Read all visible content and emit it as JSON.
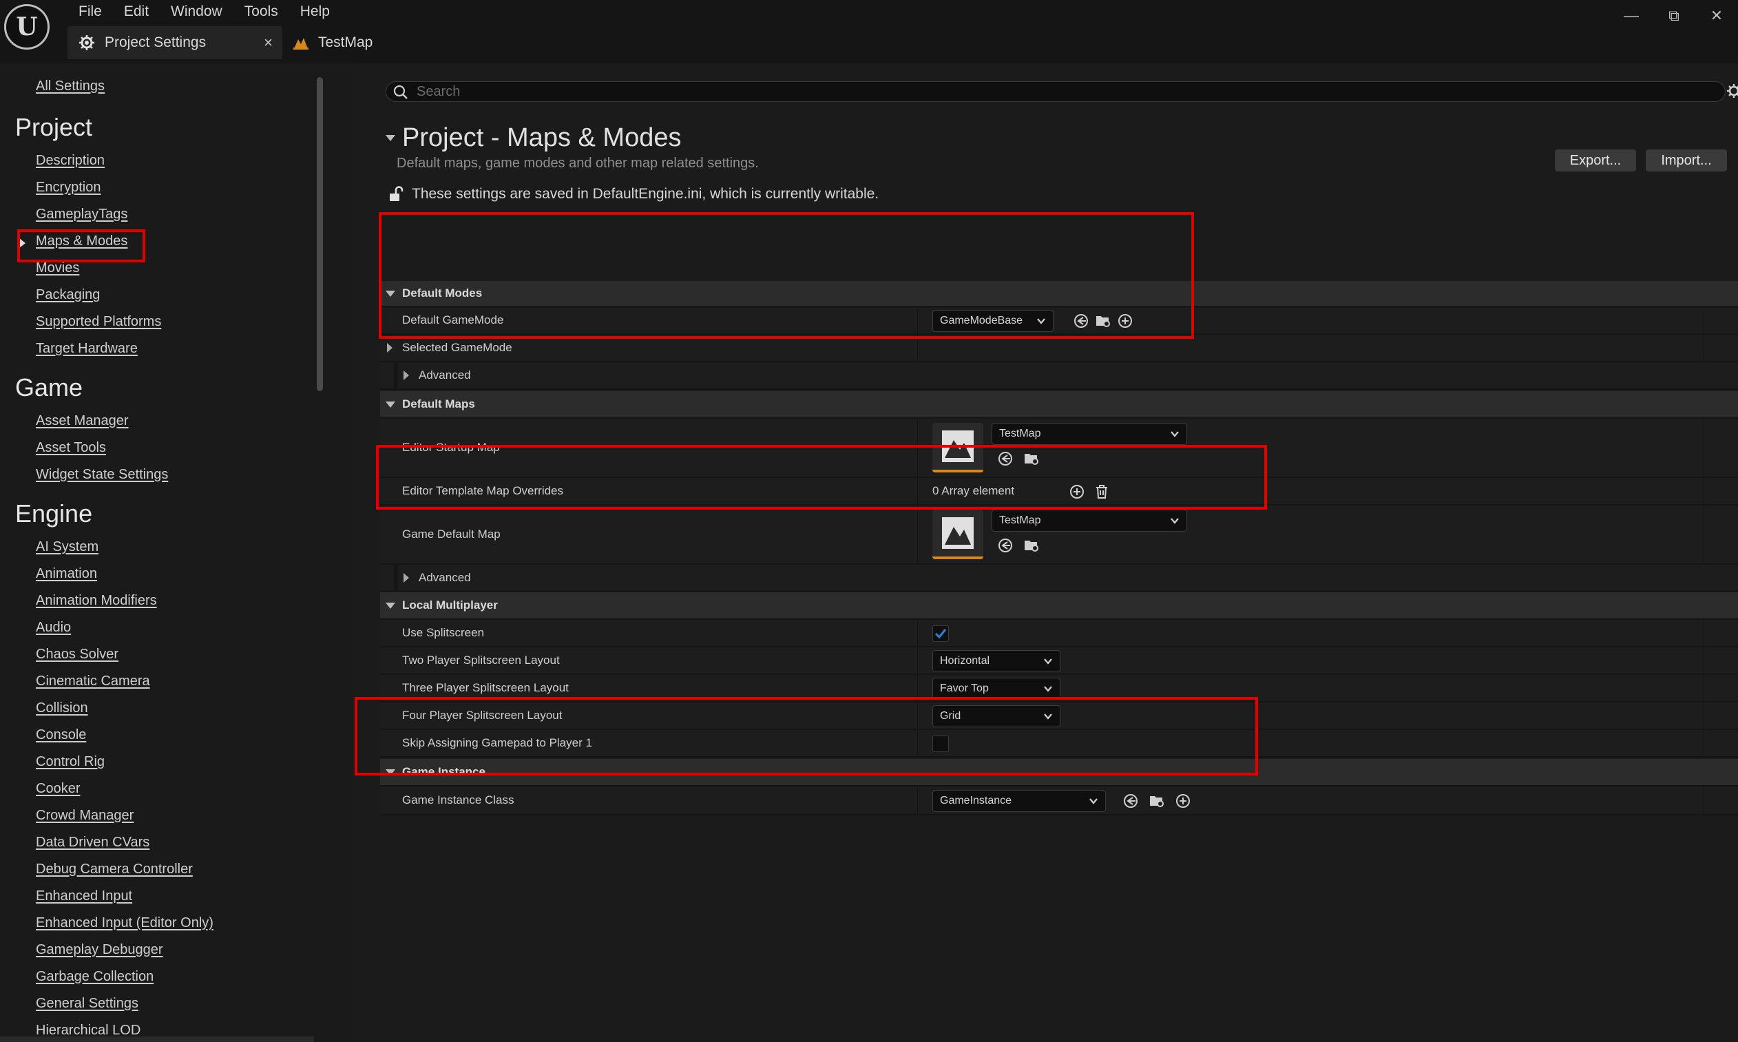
{
  "menu": [
    "File",
    "Edit",
    "Window",
    "Tools",
    "Help"
  ],
  "window_controls": {
    "minimize": "—",
    "restore": "⧉",
    "close": "✕"
  },
  "tabs": [
    {
      "label": "Project Settings",
      "close": "×"
    },
    {
      "label": "TestMap"
    }
  ],
  "sidebar": {
    "all_settings": "All Settings",
    "categories": {
      "project": "Project",
      "game": "Game",
      "engine": "Engine"
    },
    "project_items": [
      "Description",
      "Encryption",
      "GameplayTags",
      "Maps & Modes",
      "Movies",
      "Packaging",
      "Supported Platforms",
      "Target Hardware"
    ],
    "game_items": [
      "Asset Manager",
      "Asset Tools",
      "Widget State Settings"
    ],
    "engine_items": [
      "AI System",
      "Animation",
      "Animation Modifiers",
      "Audio",
      "Chaos Solver",
      "Cinematic Camera",
      "Collision",
      "Console",
      "Control Rig",
      "Cooker",
      "Crowd Manager",
      "Data Driven CVars",
      "Debug Camera Controller",
      "Enhanced Input",
      "Enhanced Input (Editor Only)",
      "Gameplay Debugger",
      "Garbage Collection",
      "General Settings",
      "Hierarchical LOD"
    ]
  },
  "search": {
    "placeholder": "Search"
  },
  "page": {
    "title": "Project - Maps & Modes",
    "subtitle": "Default maps, game modes and other map related settings.",
    "export_label": "Export...",
    "import_label": "Import...",
    "writable_notice": "These settings are saved in DefaultEngine.ini, which is currently writable."
  },
  "sections": {
    "default_modes": {
      "title": "Default Modes",
      "default_gamemode_label": "Default GameMode",
      "default_gamemode_value": "GameModeBase",
      "selected_gamemode_label": "Selected GameMode",
      "advanced_label": "Advanced"
    },
    "default_maps": {
      "title": "Default Maps",
      "editor_startup_map_label": "Editor Startup Map",
      "editor_startup_map_value": "TestMap",
      "template_overrides_label": "Editor Template Map Overrides",
      "template_overrides_value": "0 Array element",
      "game_default_map_label": "Game Default Map",
      "game_default_map_value": "TestMap",
      "advanced_label": "Advanced"
    },
    "local_multiplayer": {
      "title": "Local Multiplayer",
      "use_splitscreen_label": "Use Splitscreen",
      "use_splitscreen_checked": true,
      "two_player_label": "Two Player Splitscreen Layout",
      "two_player_value": "Horizontal",
      "three_player_label": "Three Player Splitscreen Layout",
      "three_player_value": "Favor Top",
      "four_player_label": "Four Player Splitscreen Layout",
      "four_player_value": "Grid",
      "skip_gamepad_label": "Skip Assigning Gamepad to Player 1",
      "skip_gamepad_checked": false
    },
    "game_instance": {
      "title": "Game Instance",
      "class_label": "Game Instance Class",
      "class_value": "GameInstance"
    }
  },
  "colors": {
    "highlight": "#e00000",
    "accent_orange": "#d5891d",
    "check_blue": "#2f7fd4"
  }
}
